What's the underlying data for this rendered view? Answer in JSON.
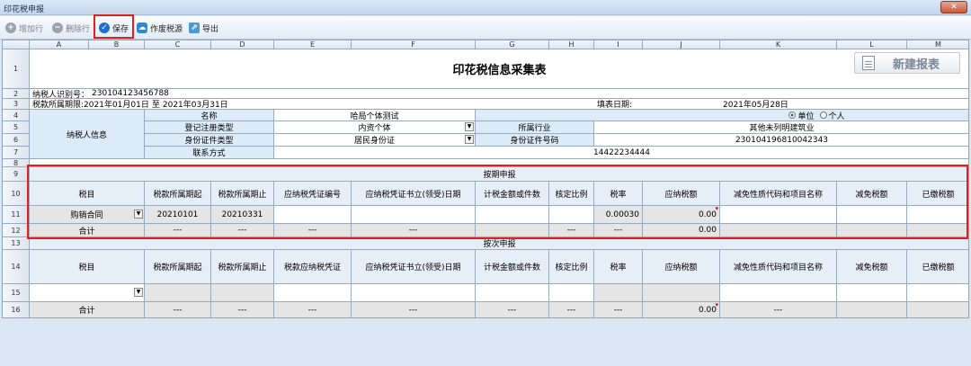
{
  "window": {
    "title": "印花税申报",
    "close": "✕"
  },
  "toolbar": {
    "add_row": "增加行",
    "delete_row": "删除行",
    "save": "保存",
    "void_source": "作废税源",
    "export": "导出"
  },
  "columns": [
    "A",
    "B",
    "C",
    "D",
    "E",
    "F",
    "G",
    "H",
    "I",
    "J",
    "K",
    "L",
    "M"
  ],
  "rows": [
    "1",
    "2",
    "3",
    "4",
    "5",
    "6",
    "7",
    "8",
    "9",
    "10",
    "11",
    "12",
    "13",
    "14",
    "15",
    "16"
  ],
  "form": {
    "title": "印花税信息采集表",
    "new_report": "新建报表",
    "taxpayer_id_label": "纳税人识别号：",
    "taxpayer_id": "230104123456788",
    "period_label": "税款所属期限:",
    "period_start": "2021年01月01日",
    "period_to": "至",
    "period_end": "2021年03月31日",
    "fill_date_label": "填表日期:",
    "fill_date": "2021年05月28日",
    "taxpayer_info": "纳税人信息",
    "name_label": "名称",
    "name_value": "哈局个体测试",
    "radio_unit": "单位",
    "radio_individual": "个人",
    "reg_type_label": "登记注册类型",
    "reg_type_value": "内资个体",
    "industry_label": "所属行业",
    "industry_value": "其他未列明建筑业",
    "id_type_label": "身份证件类型",
    "id_type_value": "居民身份证",
    "id_no_label": "身份证件号码",
    "id_no_value": "230104196810042343",
    "contact_label": "联系方式",
    "contact_value": "14422234444"
  },
  "period_section": {
    "title": "按期申报",
    "headers": [
      "税目",
      "税款所属期起",
      "税款所属期止",
      "应纳税凭证编号",
      "应纳税凭证书立(领受)日期",
      "计税金额或件数",
      "核定比例",
      "税率",
      "应纳税额",
      "减免性质代码和项目名称",
      "减免税额",
      "已缴税额"
    ],
    "row": {
      "item": "购销合同",
      "start": "20210101",
      "end": "20210331",
      "rate": "0.00030",
      "tax": "0.00"
    },
    "total_label": "合计",
    "dash": "---",
    "total_tax": "0.00"
  },
  "times_section": {
    "title": "按次申报",
    "headers": [
      "税目",
      "税款所属期起",
      "税款所属期止",
      "税款应纳税凭证",
      "应纳税凭证书立(领受)日期",
      "计税金额或件数",
      "核定比例",
      "税率",
      "应纳税额",
      "减免性质代码和项目名称",
      "减免税额",
      "已缴税额"
    ],
    "total_label": "合计",
    "dash": "---",
    "total_tax": "0.00"
  }
}
